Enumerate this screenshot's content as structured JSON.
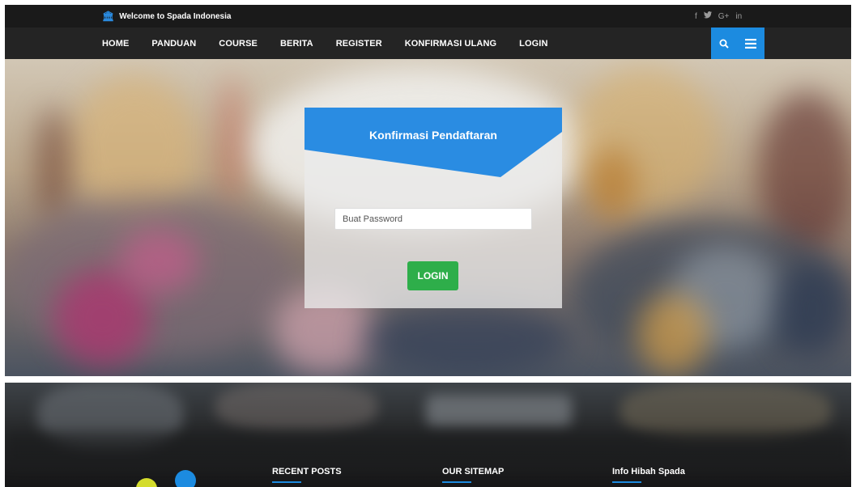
{
  "topbar": {
    "welcome_text": "Welcome to Spada Indonesia",
    "welcome_icon": "institution-icon",
    "social": [
      {
        "name": "facebook-icon",
        "glyph": "f"
      },
      {
        "name": "twitter-icon",
        "glyph": "🐦"
      },
      {
        "name": "google-plus-icon",
        "glyph": "G+"
      },
      {
        "name": "linkedin-icon",
        "glyph": "in"
      }
    ]
  },
  "nav": {
    "items": [
      "HOME",
      "PANDUAN",
      "COURSE",
      "BERITA",
      "REGISTER",
      "KONFIRMASI ULANG",
      "LOGIN"
    ],
    "search_icon": "search-icon",
    "menu_icon": "hamburger-menu-icon"
  },
  "form": {
    "title": "Konfirmasi Pendaftaran",
    "password_placeholder": "Buat Password",
    "password_value": "",
    "login_label": "LOGIN"
  },
  "footer": {
    "columns": [
      "RECENT POSTS",
      "OUR SITEMAP",
      "Info Hibah Spada"
    ]
  },
  "colors": {
    "accent": "#1c8be0",
    "login_button": "#2eae4a",
    "topbar_bg": "#1a1a1a",
    "navbar_bg": "#242424"
  }
}
